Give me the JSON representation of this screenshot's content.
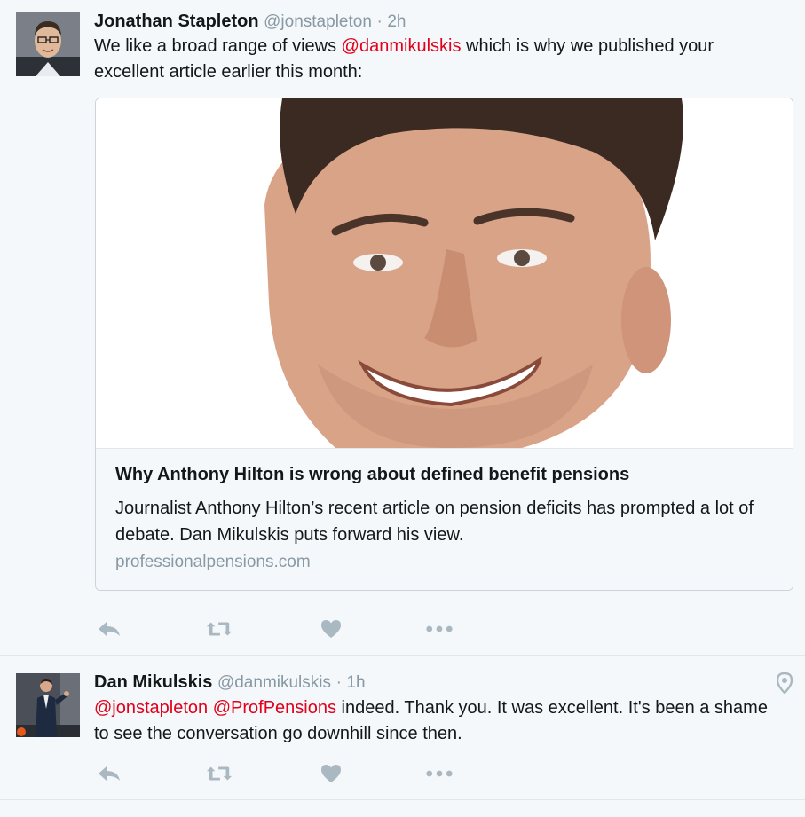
{
  "tweets": [
    {
      "name": "Jonathan Stapleton",
      "handle": "@jonstapleton",
      "separator": "·",
      "time": "2h",
      "text_pre": "We like a broad range of views ",
      "mention": "@danmikulskis",
      "text_post": " which is why we published your excellent article earlier this month:",
      "card": {
        "title": "Why Anthony Hilton is wrong about defined benefit pensions",
        "description": "Journalist Anthony Hilton’s recent article on pension deficits has prompted a lot of debate. Dan Mikulskis puts forward his view.",
        "domain": "professionalpensions.com"
      },
      "actions": [
        "reply-icon",
        "retweet-icon",
        "like-icon",
        "more-icon"
      ]
    },
    {
      "name": "Dan Mikulskis",
      "handle": "@danmikulskis",
      "separator": "·",
      "time": "1h",
      "mention1": "@jonstapleton",
      "mention2": "@ProfPensions",
      "text_post": " indeed. Thank you. It was excellent. It's been a shame to see the conversation go downhill since then.",
      "actions": [
        "reply-icon",
        "retweet-icon",
        "like-icon",
        "more-icon"
      ],
      "location_icon": "location-pin-icon"
    }
  ],
  "colors": {
    "background": "#f5f8fa",
    "mention": "#e2001a",
    "secondary_text": "#8899a6",
    "icon": "#aab8c2",
    "border": "#e1e8ed"
  }
}
